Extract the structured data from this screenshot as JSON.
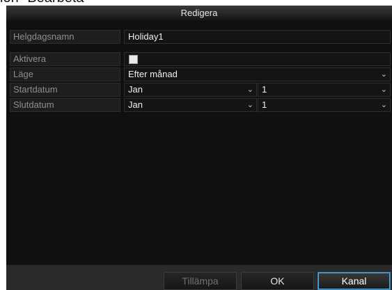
{
  "caption": "ion \"Bearbeta\"",
  "dialog": {
    "title": "Redigera"
  },
  "form": {
    "holiday_name": {
      "label": "Helgdagsnamn",
      "value": "Holiday1"
    },
    "enable": {
      "label": "Aktivera",
      "checked": false
    },
    "mode": {
      "label": "Läge",
      "value": "Efter månad"
    },
    "start_date": {
      "label": "Startdatum",
      "month": "Jan",
      "day": "1"
    },
    "end_date": {
      "label": "Slutdatum",
      "month": "Jan",
      "day": "1"
    }
  },
  "buttons": {
    "apply": "Tillämpa",
    "ok": "OK",
    "cancel": "Kanal"
  },
  "icons": {
    "dropdown": "chevron-down-icon"
  },
  "colors": {
    "focus_border": "#2d7fb8",
    "text": "#f0f0f0",
    "label_text": "#8e8e8e"
  }
}
